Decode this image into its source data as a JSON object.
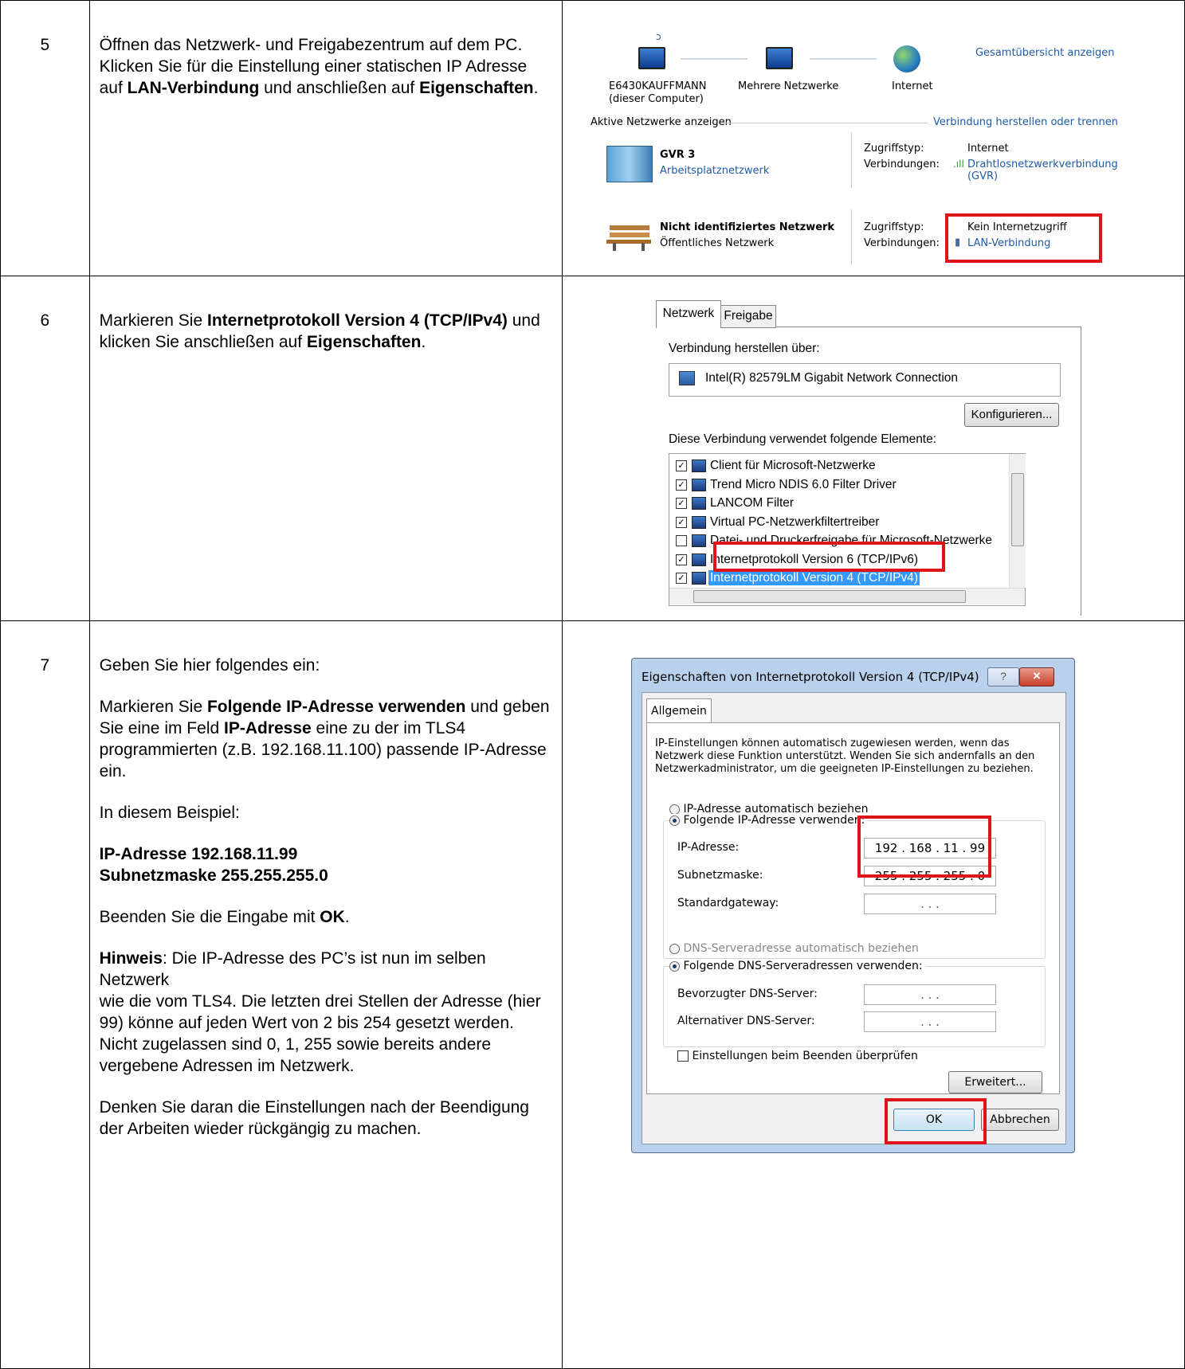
{
  "steps": [
    {
      "number": "5",
      "paragraphs": [
        [
          {
            "t": "Öffnen das Netzwerk- und Freigabezentrum auf dem PC. Klicken Sie für die Einstellung einer statischen IP Adresse auf "
          },
          {
            "t": "LAN-Verbindung",
            "b": true
          },
          {
            "t": " und anschließen auf "
          },
          {
            "t": "Eigenschaften",
            "b": true
          },
          {
            "t": "."
          }
        ]
      ]
    },
    {
      "number": "6",
      "paragraphs": [
        [
          {
            "t": "Markieren Sie "
          },
          {
            "t": "Internetprotokoll Version 4 (TCP/IPv4)",
            "b": true
          },
          {
            "t": " und klicken Sie anschließen auf "
          },
          {
            "t": "Eigenschaften",
            "b": true
          },
          {
            "t": "."
          }
        ]
      ]
    },
    {
      "number": "7",
      "paragraphs": [
        [
          {
            "t": "Geben Sie hier folgendes ein:"
          }
        ],
        [
          {
            "t": "Markieren Sie "
          },
          {
            "t": "Folgende IP-Adresse verwenden",
            "b": true
          },
          {
            "t": " und geben Sie eine im Feld "
          },
          {
            "t": "IP-Adresse",
            "b": true
          },
          {
            "t": " eine zu der im TLS4 programmierten (z.B. 192.168.11.100) passende IP-Adresse ein."
          }
        ],
        [
          {
            "t": "In diesem Beispiel:"
          }
        ],
        [
          {
            "t": "IP-Adresse            192.168.11.99",
            "b": true,
            "br": true
          },
          {
            "t": "Subnetzmaske    255.255.255.0",
            "b": true
          }
        ],
        [
          {
            "t": "Beenden Sie die Eingabe mit "
          },
          {
            "t": "OK",
            "b": true
          },
          {
            "t": "."
          }
        ],
        [
          {
            "t": "Hinweis",
            "b": true
          },
          {
            "t": ": Die IP-Adresse des PC’s ist nun im selben Netzwerk",
            "br": true
          },
          {
            "t": " wie die vom TLS4. Die letzten drei Stellen der Adresse (hier 99) könne auf jeden Wert von 2 bis 254 gesetzt werden. Nicht zugelassen sind 0, 1, 255 sowie bereits andere vergebene Adressen im Netzwerk."
          }
        ],
        [
          {
            "t": "Denken Sie daran die Einstellungen nach der Beendigung der Arbeiten wieder rückgängig zu machen."
          }
        ]
      ]
    }
  ],
  "shot5": {
    "pc_name": "E6430KAUFFMANN",
    "pc_sub": "(dieser Computer)",
    "multi": "Mehrere Netzwerke",
    "internet": "Internet",
    "overview_link": "Gesamtübersicht anzeigen",
    "active_label": "Aktive Netzwerke anzeigen",
    "connect_link": "Verbindung herstellen oder trennen",
    "net1_name": "GVR  3",
    "net1_type": "Arbeitsplatznetzwerk",
    "access_label": "Zugriffstyp:",
    "conn_label": "Verbindungen:",
    "net1_access": "Internet",
    "net1_conn": "Drahtlosnetzwerkverbindung",
    "net1_conn2": "(GVR)",
    "net2_name": "Nicht identifiziertes Netzwerk",
    "net2_type": "Öffentliches Netzwerk",
    "net2_access": "Kein Internetzugriff",
    "net2_conn": "LAN-Verbindung"
  },
  "shot6": {
    "tab_active": "Netzwerk",
    "tab_other": "Freigabe",
    "connect_via": "Verbindung herstellen über:",
    "adapter": "Intel(R) 82579LM Gigabit Network Connection",
    "configure": "Konfigurieren...",
    "elements_label": "Diese Verbindung verwendet folgende Elemente:",
    "items": [
      {
        "label": "Client für Microsoft-Netzwerke",
        "checked": true
      },
      {
        "label": "Trend Micro NDIS 6.0 Filter Driver",
        "checked": true
      },
      {
        "label": "LANCOM Filter",
        "checked": true
      },
      {
        "label": "Virtual PC-Netzwerkfiltertreiber",
        "checked": true
      },
      {
        "label": "Datei- und Druckerfreigabe für Microsoft-Netzwerke",
        "checked": false
      },
      {
        "label": "Internetprotokoll Version 6 (TCP/IPv6)",
        "checked": true
      },
      {
        "label": "Internetprotokoll Version 4 (TCP/IPv4)",
        "checked": true,
        "selected": true
      }
    ]
  },
  "shot7": {
    "title": "Eigenschaften von Internetprotokoll Version 4 (TCP/IPv4)",
    "help": "?",
    "close": "×",
    "tab": "Allgemein",
    "info": "IP-Einstellungen können automatisch zugewiesen werden, wenn das Netzwerk diese Funktion unterstützt. Wenden Sie sich andernfalls an den Netzwerkadministrator, um die geeigneten IP-Einstellungen zu beziehen.",
    "radio_auto_ip": "IP-Adresse automatisch beziehen",
    "radio_manual_ip": "Folgende IP-Adresse verwenden:",
    "ip_label": "IP-Adresse:",
    "ip_value": "192 . 168 . 11 . 99",
    "mask_label": "Subnetzmaske:",
    "mask_value": "255 . 255 . 255 . 0",
    "gateway_label": "Standardgateway:",
    "empty_ip": ".        .        .",
    "radio_auto_dns": "DNS-Serveradresse automatisch beziehen",
    "radio_manual_dns": "Folgende DNS-Serveradressen verwenden:",
    "dns1_label": "Bevorzugter DNS-Server:",
    "dns2_label": "Alternativer DNS-Server:",
    "validate": "Einstellungen beim Beenden überprüfen",
    "advanced": "Erweitert...",
    "ok": "OK",
    "cancel": "Abbrechen"
  }
}
